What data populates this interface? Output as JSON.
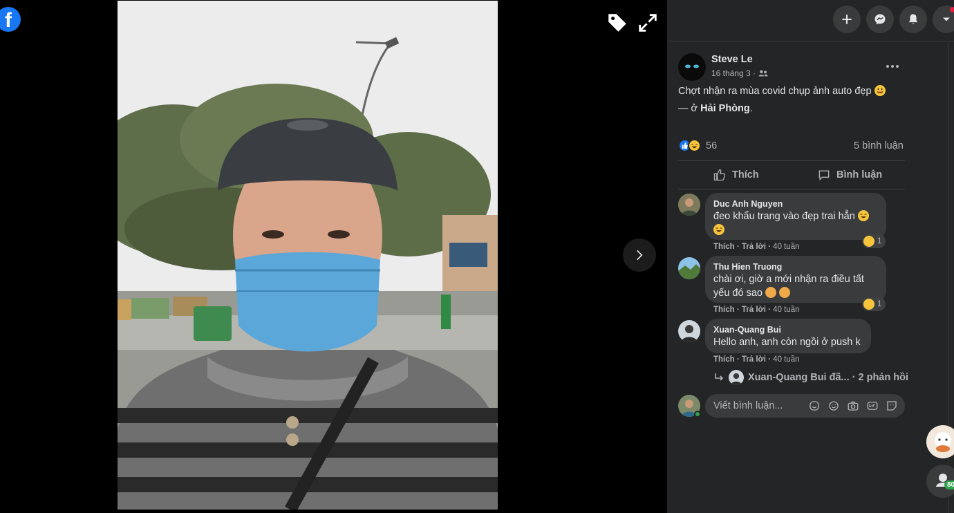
{
  "viewer": {
    "logo_letter": "f"
  },
  "post": {
    "author": "Steve Le",
    "time": "16 tháng 3 ·",
    "text": "Chợt nhận ra mùa covid chụp ảnh auto đẹp",
    "location_prefix": "— ở",
    "location": "Hải Phòng",
    "location_suffix": ".",
    "reaction_count": "56",
    "comment_count": "5 bình luận",
    "like_label": "Thích",
    "comment_label": "Bình luận"
  },
  "comments": [
    {
      "name": "Duc Anh Nguyen",
      "text": "đeo khẩu trang vào đẹp trai hẳn",
      "like": "Thích",
      "reply": "Trả lời",
      "time": "40 tuần",
      "reactions": "1"
    },
    {
      "name": "Thu Hien Truong",
      "text_line1": "chài ơi, giờ a mới nhận ra điều tất",
      "text_line2": "yếu đó sao",
      "like": "Thích",
      "reply": "Trả lời",
      "time": "40 tuần",
      "reactions": "1"
    },
    {
      "name": "Xuan-Quang Bui",
      "text": "Hello anh, anh còn ngồi ở push k",
      "like": "Thích",
      "reply": "Trả lời",
      "time": "40 tuần"
    }
  ],
  "replies_summary": "Xuan-Quang Bui đã... · 2 phản hồi",
  "write_comment": {
    "placeholder": "Viết bình luận..."
  },
  "side": {
    "badge": "80"
  },
  "colors": {
    "accent": "#1877f2",
    "panel": "#242526",
    "bubble": "#3a3b3c"
  }
}
